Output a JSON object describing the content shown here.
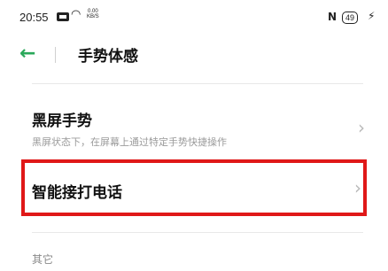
{
  "status_bar": {
    "time": "20:55",
    "net_speed_value": "0.00",
    "net_speed_unit": "KB/S",
    "battery": "49"
  },
  "header": {
    "title": "手势体感"
  },
  "items": [
    {
      "title": "黑屏手势",
      "subtitle": "黑屏状态下，在屏幕上通过特定手势快捷操作"
    },
    {
      "title": "智能接打电话"
    }
  ],
  "sections": {
    "other_label": "其它"
  },
  "colors": {
    "accent": "#2aa85a",
    "highlight_border": "#e01818"
  }
}
